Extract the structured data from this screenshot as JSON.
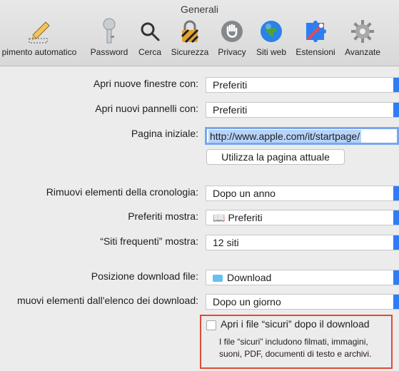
{
  "window": {
    "title": "Generali"
  },
  "toolbar": {
    "items": [
      {
        "label": "pimento automatico",
        "icon": "pencil-icon"
      },
      {
        "label": "Password",
        "icon": "key-icon"
      },
      {
        "label": "Cerca",
        "icon": "search-icon"
      },
      {
        "label": "Sicurezza",
        "icon": "lock-icon"
      },
      {
        "label": "Privacy",
        "icon": "hand-icon"
      },
      {
        "label": "Siti web",
        "icon": "globe-icon"
      },
      {
        "label": "Estensioni",
        "icon": "puzzle-icon"
      },
      {
        "label": "Avanzate",
        "icon": "gear-icon"
      }
    ]
  },
  "general": {
    "new_windows": {
      "label": "Apri nuove finestre con:",
      "value": "Preferiti"
    },
    "new_tabs": {
      "label": "Apri nuovi pannelli con:",
      "value": "Preferiti"
    },
    "homepage": {
      "label": "Pagina iniziale:",
      "value": "http://www.apple.com/it/startpage/"
    },
    "use_current_page_button": "Utilizza la pagina attuale",
    "remove_history": {
      "label": "Rimuovi elementi della cronologia:",
      "value": "Dopo un anno"
    },
    "favorites_shows": {
      "label": "Preferiti mostra:",
      "value": "Preferiti"
    },
    "top_sites_shows": {
      "label": "“Siti frequenti” mostra:",
      "value": "12 siti"
    },
    "download_location": {
      "label": "Posizione download file:",
      "value": "Download"
    },
    "remove_download_list": {
      "label": "muovi elementi dall'elenco dei download:",
      "value": "Dopo un giorno"
    },
    "open_safe_files": {
      "label": "Apri i file “sicuri” dopo il download",
      "help": "I file “sicuri” includono filmati, immagini, suoni, PDF, documenti di testo e archivi.",
      "checked": false
    }
  },
  "colors": {
    "accent": "#2f7cf6",
    "highlight_border": "#df4b37"
  }
}
